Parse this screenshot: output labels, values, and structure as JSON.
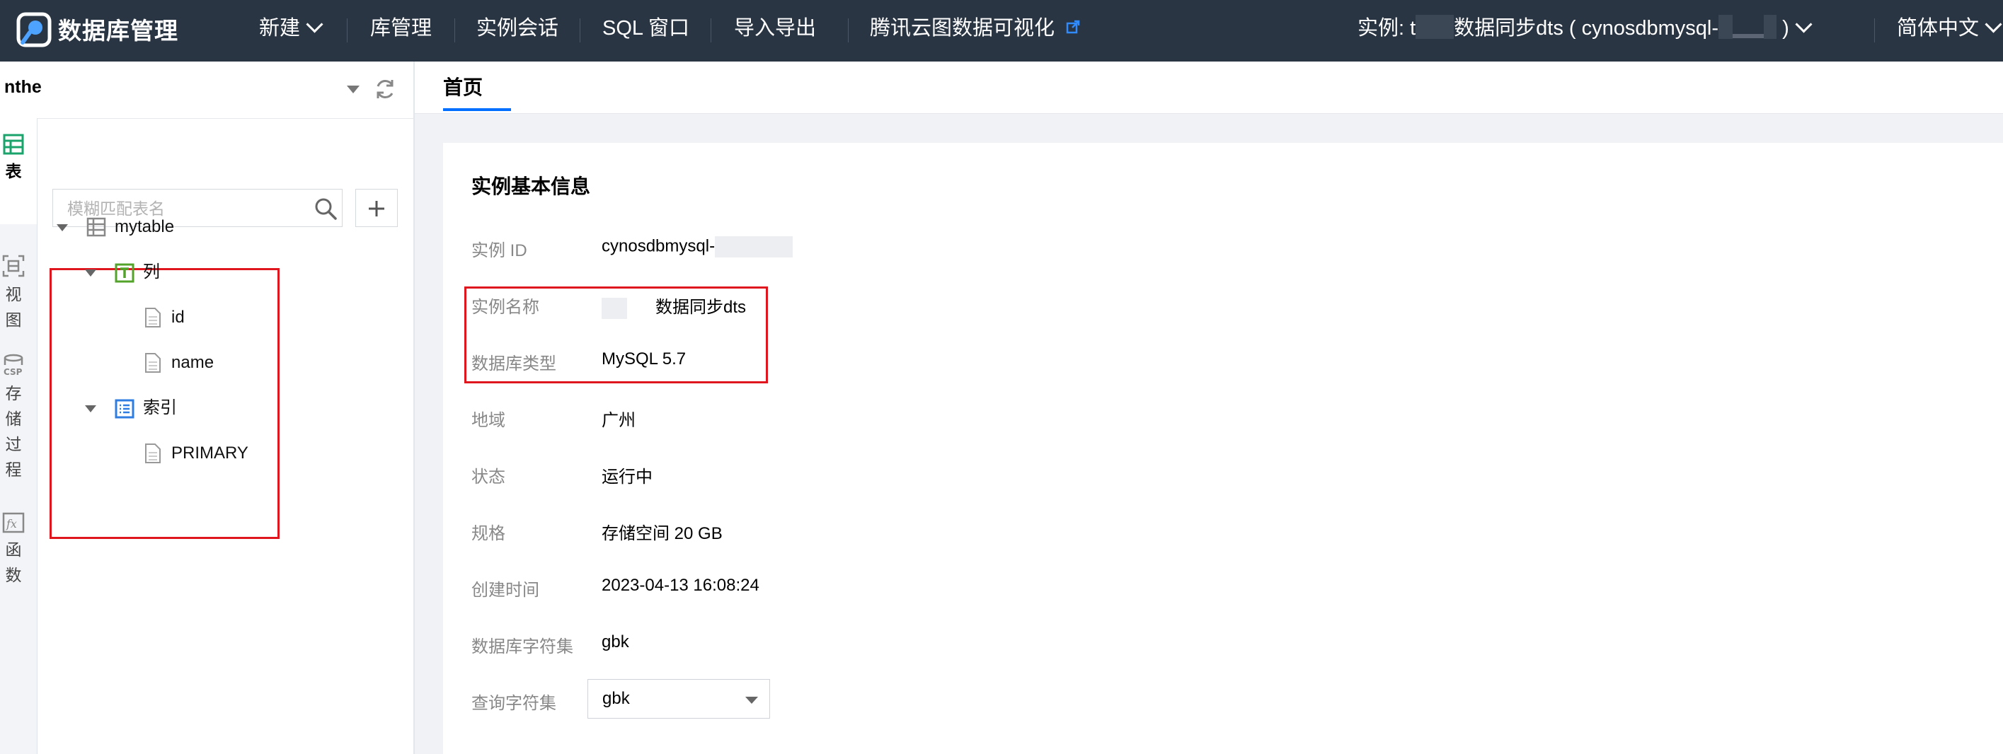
{
  "header": {
    "app_name": "数据库管理",
    "nav": [
      {
        "label": "新建"
      },
      {
        "label": "库管理"
      },
      {
        "label": "实例会话"
      },
      {
        "label": "SQL 窗口"
      },
      {
        "label": "导入导出"
      },
      {
        "label": "腾讯云图数据可视化"
      }
    ],
    "instance_prefix": "实例: t",
    "instance_name_part": "数据同步dts ( cynosdbmysql-",
    "instance_suffix": ")",
    "language": "简体中文"
  },
  "sidebar": {
    "database_name": "nthe",
    "rail": [
      {
        "label": "表",
        "icon": "table-grid-icon",
        "active": true
      },
      {
        "label": "视图",
        "icon": "view-icon"
      },
      {
        "label": "存储过程",
        "icon": "stored-procedure-icon"
      },
      {
        "label": "函数",
        "icon": "function-fx-icon"
      }
    ],
    "search_placeholder": "模糊匹配表名",
    "tree": {
      "table": "mytable",
      "columns_group": "列",
      "columns": [
        "id",
        "name"
      ],
      "index_group": "索引",
      "indexes": [
        "PRIMARY"
      ]
    }
  },
  "main": {
    "tab": "首页",
    "card_title": "实例基本信息",
    "fields": [
      {
        "label": "实例 ID",
        "value": "cynosdbmysql-"
      },
      {
        "label": "实例名称",
        "value": "数据同步dts"
      },
      {
        "label": "数据库类型",
        "value": "MySQL 5.7"
      },
      {
        "label": "地域",
        "value": "广州"
      },
      {
        "label": "状态",
        "value": "运行中"
      },
      {
        "label": "规格",
        "value": "存储空间 20 GB"
      },
      {
        "label": "创建时间",
        "value": "2023-04-13 16:08:24"
      },
      {
        "label": "数据库字符集",
        "value": "gbk"
      }
    ],
    "query_charset_label": "查询字符集",
    "query_charset_value": "gbk"
  },
  "colors": {
    "topbar": "#2a3543",
    "accent_blue": "#006eff",
    "highlight_red": "#e0161f"
  }
}
